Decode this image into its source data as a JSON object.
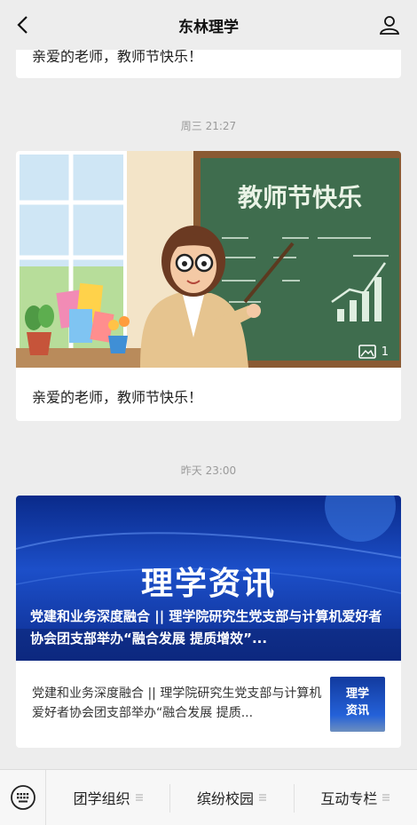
{
  "header": {
    "title": "东林理学"
  },
  "feed": {
    "prev_card": {
      "text": "亲爱的老师，教师节快乐！"
    },
    "messages": [
      {
        "time": "周三 21:27",
        "image_text": "教师节快乐",
        "image_count": "1",
        "caption": "亲爱的老师，教师节快乐！"
      },
      {
        "time": "昨天 23:00",
        "banner_title": "理学资讯",
        "banner_headline": "党建和业务深度融合 || 理学院研究生党支部与计算机爱好者协会团支部举办“融合发展 提质增效”...",
        "description": "党建和业务深度融合 || 理学院研究生党支部与计算机爱好者协会团支部举办“融合发展 提质...",
        "thumb_text": "理学\n资讯"
      }
    ]
  },
  "bottom_menu": {
    "items": [
      {
        "label": "团学组织"
      },
      {
        "label": "缤纷校园"
      },
      {
        "label": "互动专栏"
      }
    ]
  },
  "colors": {
    "banner_blue": "#1c4fc9",
    "background": "#ededed",
    "board_green": "#3f6d4e"
  }
}
